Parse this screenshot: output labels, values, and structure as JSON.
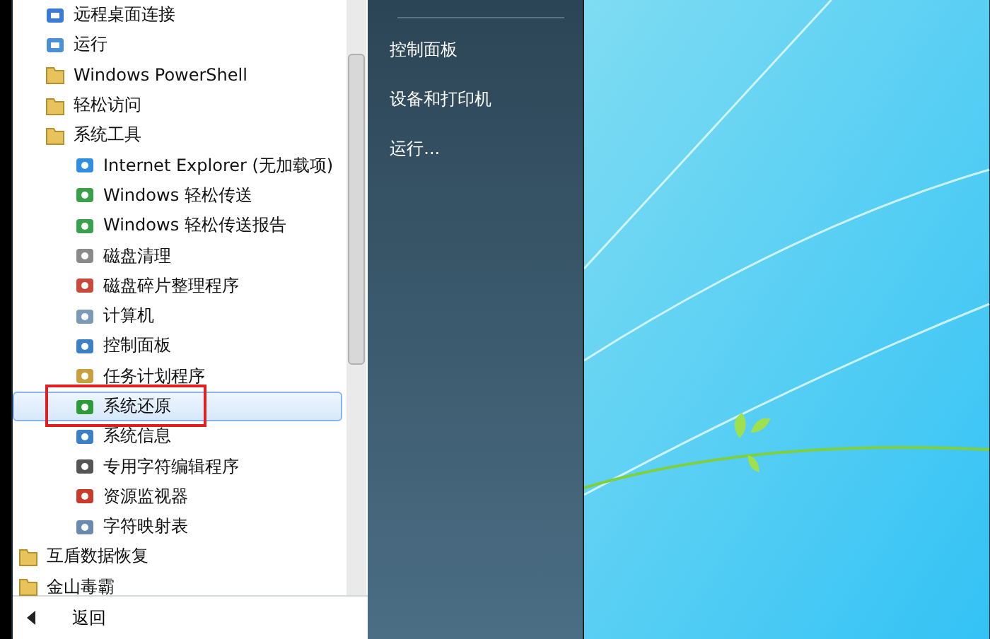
{
  "programs_list": {
    "accessory_items": [
      {
        "label": "远程桌面连接",
        "kind": "remote",
        "selected": false
      },
      {
        "label": "运行",
        "kind": "run",
        "selected": false
      },
      {
        "label": "Windows PowerShell",
        "kind": "folder",
        "selected": false
      },
      {
        "label": "轻松访问",
        "kind": "folder",
        "selected": false
      },
      {
        "label": "系统工具",
        "kind": "folder",
        "selected": false,
        "children": [
          {
            "label": "Internet Explorer (无加载项)",
            "kind": "browser",
            "selected": false,
            "outlined": false
          },
          {
            "label": "Windows 轻松传送",
            "kind": "transfer",
            "selected": false,
            "outlined": false
          },
          {
            "label": "Windows 轻松传送报告",
            "kind": "transfer",
            "selected": false,
            "outlined": false
          },
          {
            "label": "磁盘清理",
            "kind": "disk",
            "selected": false,
            "outlined": false
          },
          {
            "label": "磁盘碎片整理程序",
            "kind": "defrag",
            "selected": false,
            "outlined": false
          },
          {
            "label": "计算机",
            "kind": "computer",
            "selected": false,
            "outlined": false
          },
          {
            "label": "控制面板",
            "kind": "panel",
            "selected": false,
            "outlined": false
          },
          {
            "label": "任务计划程序",
            "kind": "clock",
            "selected": false,
            "outlined": false
          },
          {
            "label": "系统还原",
            "kind": "restore",
            "selected": true,
            "outlined": true
          },
          {
            "label": "系统信息",
            "kind": "panel",
            "selected": false,
            "outlined": false
          },
          {
            "label": "专用字符编辑程序",
            "kind": "edit",
            "selected": false,
            "outlined": false
          },
          {
            "label": "资源监视器",
            "kind": "monitor",
            "selected": false,
            "outlined": false
          },
          {
            "label": "字符映射表",
            "kind": "charmap",
            "selected": false,
            "outlined": false
          }
        ]
      }
    ],
    "program_folders": [
      {
        "label": "互盾数据恢复",
        "kind": "folder",
        "selected": false
      },
      {
        "label": "金山毒霸",
        "kind": "folder",
        "selected": false
      }
    ],
    "back_button": {
      "label": "返回"
    }
  },
  "right_pane": {
    "links": [
      "控制面板",
      "设备和打印机",
      "运行..."
    ]
  }
}
